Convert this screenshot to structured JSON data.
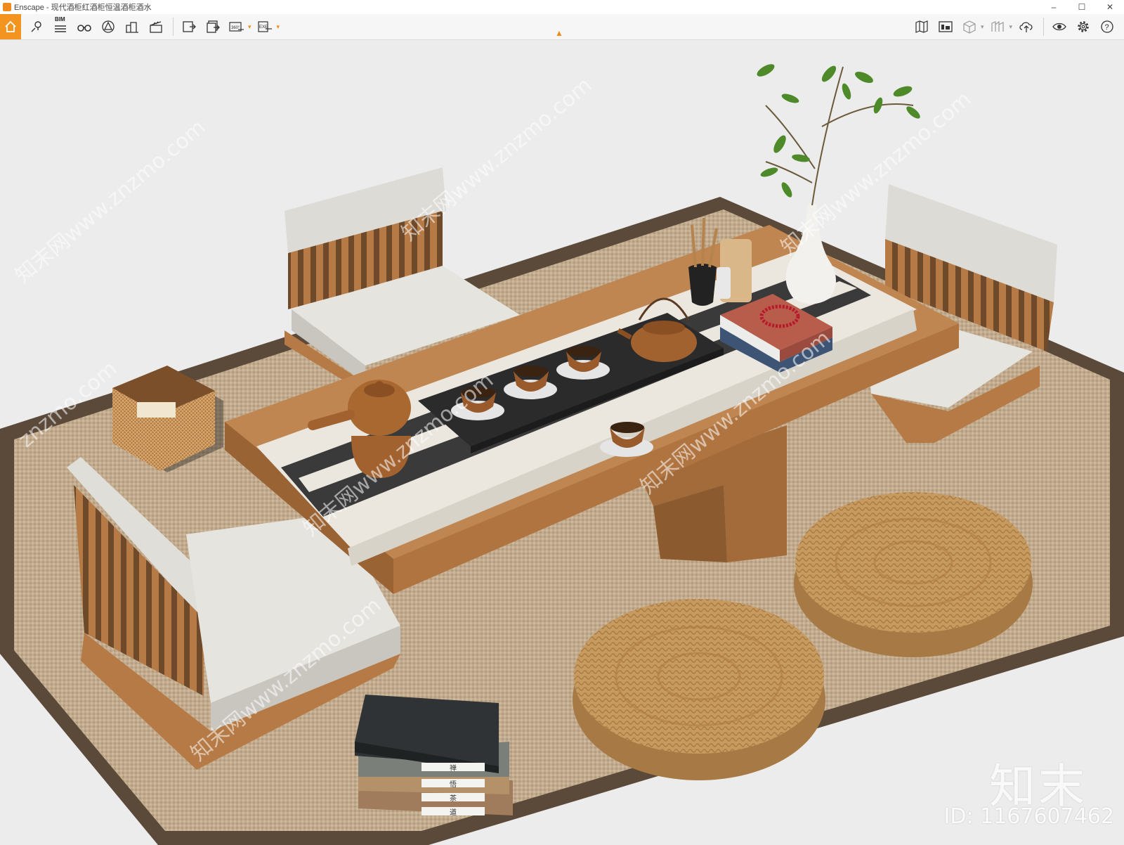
{
  "window": {
    "title": "Enscape - 现代酒柜红酒柜恒温酒柜酒水",
    "controls": [
      "minimize-icon",
      "maximize-icon",
      "close-icon"
    ]
  },
  "toolbar": {
    "bim_label": "BIM",
    "left_icons": [
      "home-icon",
      "map-pin-icon",
      "bim-list-icon",
      "binoculars-icon",
      "perspective-icon",
      "buildings-icon",
      "clapper-icon",
      "screenshot-export-icon",
      "batch-export-icon",
      "panorama-360-icon",
      "exe-export-icon"
    ],
    "right_icons": [
      "map-book-icon",
      "asset-library-icon",
      "cube-icon",
      "material-icon",
      "upload-icon",
      "eye-icon",
      "gear-icon",
      "help-icon"
    ],
    "panorama_label": "360°",
    "exe_label": "EXE",
    "help_label": "?"
  },
  "viewport": {
    "brand_mark": "知末",
    "image_id": "ID: 1167607462",
    "watermark": "知末网www.znzmo.com",
    "watermark_secondary": "znzmo.com",
    "book_spine_labels": [
      "禅",
      "悟",
      "茶",
      "道"
    ],
    "colors": {
      "background": "#ececec",
      "rug_border": "#5b4a3a",
      "rug_weave": "#c2ab8e",
      "wood": "#b57a45",
      "cushion": "#e8e6e2",
      "table_runner": "#ebe7df",
      "tea_tray": "#2b2b2b",
      "pottery": "#9a5b2c",
      "straw": "#c79a5f",
      "accent": "#f39421"
    }
  }
}
